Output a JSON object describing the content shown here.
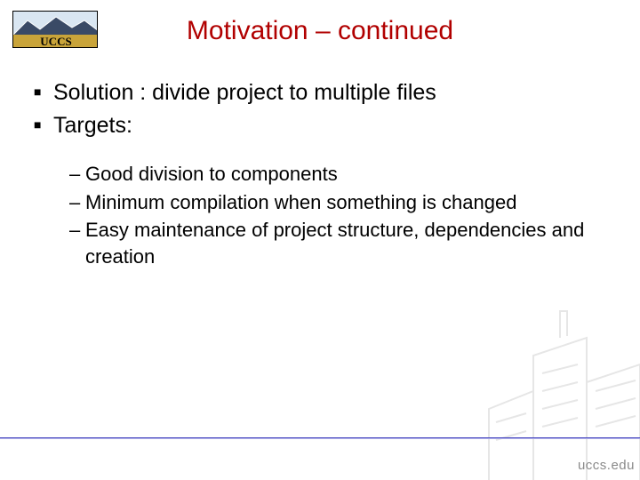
{
  "logo": {
    "text": "UCCS"
  },
  "title": "Motivation – continued",
  "bullets": [
    {
      "text": "Solution : divide project to multiple files"
    },
    {
      "text": "Targets:"
    }
  ],
  "sub_bullets": [
    {
      "text": "Good division to components"
    },
    {
      "text": "Minimum compilation when something is changed"
    },
    {
      "text": "Easy maintenance of project structure, dependencies and creation"
    }
  ],
  "footer": {
    "url": "uccs.edu"
  },
  "colors": {
    "title": "#b10000",
    "rule": "#4a4ac0"
  }
}
